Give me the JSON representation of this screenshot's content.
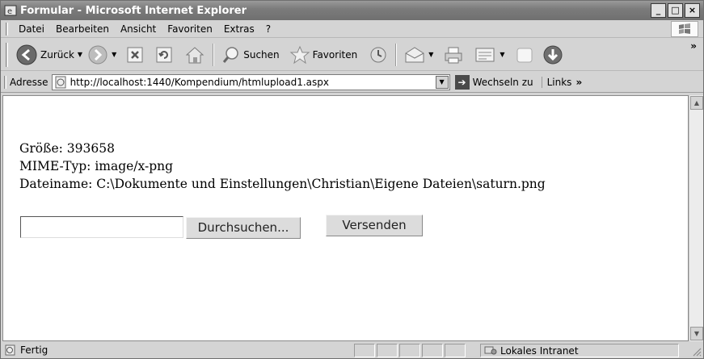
{
  "window": {
    "title": "Formular - Microsoft Internet Explorer",
    "buttons": {
      "minimize": "_",
      "maximize": "□",
      "close": "×"
    }
  },
  "menu": {
    "items": [
      "Datei",
      "Bearbeiten",
      "Ansicht",
      "Favoriten",
      "Extras",
      "?"
    ]
  },
  "toolbar": {
    "back_label": "Zurück",
    "search_label": "Suchen",
    "favorites_label": "Favoriten",
    "overflow": "»"
  },
  "address": {
    "label": "Adresse",
    "url": "http://localhost:1440/Kompendium/htmlupload1.aspx",
    "go_label": "Wechseln zu",
    "links_label": "Links",
    "links_overflow": "»"
  },
  "page": {
    "size_line": "Größe: 393658",
    "mime_line": "MIME-Typ: image/x-png",
    "filename_line": "Dateiname: C:\\Dokumente und Einstellungen\\Christian\\Eigene Dateien\\saturn.png",
    "file_value": "",
    "browse_label": "Durchsuchen...",
    "submit_label": "Versenden"
  },
  "status": {
    "text": "Fertig",
    "zone": "Lokales Intranet"
  },
  "colors": {
    "titlebar": "#7c7c7c",
    "chrome": "#d4d4d4",
    "content_bg": "#ffffff"
  }
}
